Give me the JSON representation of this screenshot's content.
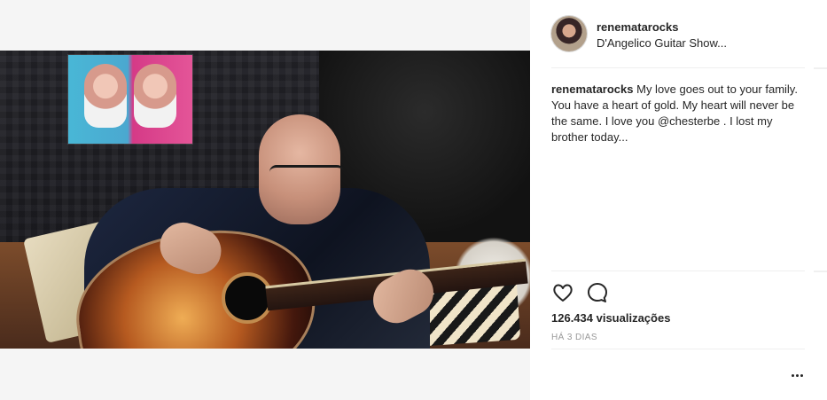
{
  "colors": {
    "text": "#262626",
    "muted": "#999999",
    "divider": "#efefef",
    "background": "#ffffff"
  },
  "post": {
    "username": "renematarocks",
    "location": "D'Angelico Guitar Show...",
    "caption_text": " My love goes out to your family. You have a heart of gold. My heart will never be the same. I love you @chesterbe . I lost my brother today...",
    "views": "126.434 visualizações",
    "time": "HÁ 3 DIAS"
  },
  "icons": {
    "like": "heart-outline-icon",
    "comment": "speech-bubble-icon",
    "more": "more-options-icon"
  }
}
